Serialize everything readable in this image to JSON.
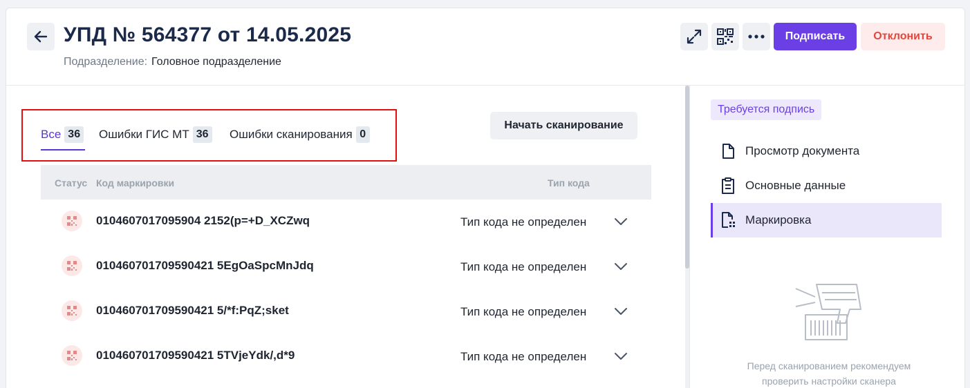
{
  "header": {
    "title": "УПД № 564377 от 14.05.2025",
    "subdivision_label": "Подразделение:",
    "subdivision_value": "Головное подразделение",
    "sign_label": "Подписать",
    "reject_label": "Отклонить",
    "icons": [
      "arrow-left-icon",
      "expand-icon",
      "qr-code-icon",
      "more-icon"
    ]
  },
  "tabs": [
    {
      "label": "Все",
      "count": "36",
      "active": true
    },
    {
      "label": "Ошибки ГИС МТ",
      "count": "36",
      "active": false
    },
    {
      "label": "Ошибки сканирования",
      "count": "0",
      "active": false
    }
  ],
  "scan_button": "Начать сканирование",
  "table": {
    "columns": {
      "status": "Статус",
      "code": "Код маркировки",
      "type": "Тип кода"
    },
    "rows": [
      {
        "code": "0104607017095904 2152(p=+D_XCZwq",
        "type": "Тип кода не определен"
      },
      {
        "code": "010460701709590421 5EgOaSpcMnJdq",
        "type": "Тип кода не определен"
      },
      {
        "code": "010460701709590421 5/*f:PqZ;sket",
        "type": "Тип кода не определен"
      },
      {
        "code": "010460701709590421 5TVjeYdk/,d*9",
        "type": "Тип кода не определен"
      }
    ]
  },
  "side_panel": {
    "status_badge": "Требуется подпись",
    "nav": [
      {
        "label": "Просмотр документа",
        "icon": "document-icon",
        "active": false
      },
      {
        "label": "Основные данные",
        "icon": "clipboard-icon",
        "active": false
      },
      {
        "label": "Маркировка",
        "icon": "marking-icon",
        "active": true
      }
    ],
    "hint_line1": "Перед сканированием рекомендуем",
    "hint_line2": "проверить настройки сканера"
  },
  "colors": {
    "accent": "#6a3fe6",
    "reject": "#e2473d",
    "highlight_box": "#e30e0e"
  }
}
